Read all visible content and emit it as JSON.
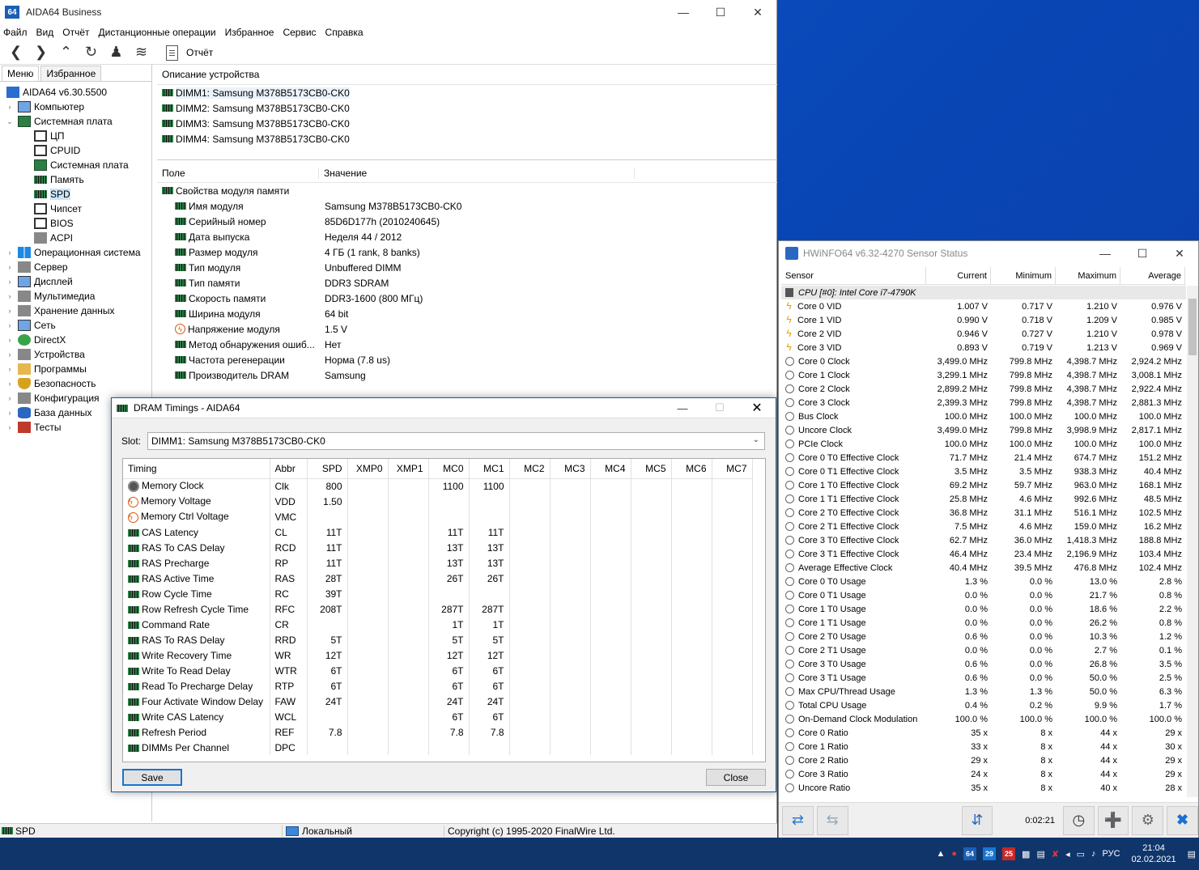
{
  "aida": {
    "title": "AIDA64 Business",
    "app_icon": "64",
    "menu": [
      "Файл",
      "Вид",
      "Отчёт",
      "Дистанционные операции",
      "Избранное",
      "Сервис",
      "Справка"
    ],
    "report_label": "Отчёт",
    "tabs": [
      "Меню",
      "Избранное"
    ],
    "tree": [
      {
        "label": "AIDA64 v6.30.5500",
        "level": 0,
        "icon": "aida64-icon",
        "exp": ""
      },
      {
        "label": "Компьютер",
        "level": 1,
        "icon": "computer-icon",
        "exp": "›"
      },
      {
        "label": "Системная плата",
        "level": 1,
        "icon": "motherboard-icon",
        "exp": "⌄"
      },
      {
        "label": "ЦП",
        "level": 2,
        "icon": "cpu-icon",
        "exp": ""
      },
      {
        "label": "CPUID",
        "level": 2,
        "icon": "cpuid-icon",
        "exp": ""
      },
      {
        "label": "Системная плата",
        "level": 2,
        "icon": "board-icon",
        "exp": ""
      },
      {
        "label": "Память",
        "level": 2,
        "icon": "memory-icon",
        "exp": ""
      },
      {
        "label": "SPD",
        "level": 2,
        "icon": "spd-icon",
        "exp": "",
        "selected": true
      },
      {
        "label": "Чипсет",
        "level": 2,
        "icon": "chipset-icon",
        "exp": ""
      },
      {
        "label": "BIOS",
        "level": 2,
        "icon": "bios-icon",
        "exp": ""
      },
      {
        "label": "ACPI",
        "level": 2,
        "icon": "acpi-icon",
        "exp": ""
      },
      {
        "label": "Операционная система",
        "level": 1,
        "icon": "windows-icon",
        "exp": "›"
      },
      {
        "label": "Сервер",
        "level": 1,
        "icon": "server-icon",
        "exp": "›"
      },
      {
        "label": "Дисплей",
        "level": 1,
        "icon": "display-icon",
        "exp": "›"
      },
      {
        "label": "Мультимедиа",
        "level": 1,
        "icon": "multimedia-icon",
        "exp": "›"
      },
      {
        "label": "Хранение данных",
        "level": 1,
        "icon": "storage-icon",
        "exp": "›"
      },
      {
        "label": "Сеть",
        "level": 1,
        "icon": "network-icon",
        "exp": "›"
      },
      {
        "label": "DirectX",
        "level": 1,
        "icon": "directx-icon",
        "exp": "›"
      },
      {
        "label": "Устройства",
        "level": 1,
        "icon": "devices-icon",
        "exp": "›"
      },
      {
        "label": "Программы",
        "level": 1,
        "icon": "programs-icon",
        "exp": "›"
      },
      {
        "label": "Безопасность",
        "level": 1,
        "icon": "security-icon",
        "exp": "›"
      },
      {
        "label": "Конфигурация",
        "level": 1,
        "icon": "config-icon",
        "exp": "›"
      },
      {
        "label": "База данных",
        "level": 1,
        "icon": "database-icon",
        "exp": "›"
      },
      {
        "label": "Тесты",
        "level": 1,
        "icon": "tests-icon",
        "exp": "›"
      }
    ],
    "device_header": "Описание устройства",
    "devices": [
      "DIMM1: Samsung M378B5173CB0-CK0",
      "DIMM2: Samsung M378B5173CB0-CK0",
      "DIMM3: Samsung M378B5173CB0-CK0",
      "DIMM4: Samsung M378B5173CB0-CK0"
    ],
    "props_header": {
      "field": "Поле",
      "value": "Значение"
    },
    "props_group": "Свойства модуля памяти",
    "props": [
      {
        "field": "Имя модуля",
        "value": "Samsung M378B5173CB0-CK0",
        "icon": "ram"
      },
      {
        "field": "Серийный номер",
        "value": "85D6D177h (2010240645)",
        "icon": "ram"
      },
      {
        "field": "Дата выпуска",
        "value": "Неделя 44 / 2012",
        "icon": "ram"
      },
      {
        "field": "Размер модуля",
        "value": "4 ГБ (1 rank, 8 banks)",
        "icon": "ram"
      },
      {
        "field": "Тип модуля",
        "value": "Unbuffered DIMM",
        "icon": "ram"
      },
      {
        "field": "Тип памяти",
        "value": "DDR3 SDRAM",
        "icon": "ram"
      },
      {
        "field": "Скорость памяти",
        "value": "DDR3-1600 (800 МГц)",
        "icon": "ram"
      },
      {
        "field": "Ширина модуля",
        "value": "64 bit",
        "icon": "ram"
      },
      {
        "field": "Напряжение модуля",
        "value": "1.5 V",
        "icon": "bolt"
      },
      {
        "field": "Метод обнаружения ошиб...",
        "value": "Нет",
        "icon": "ram"
      },
      {
        "field": "Частота регенерации",
        "value": "Норма (7.8 us)",
        "icon": "ram"
      },
      {
        "field": "Производитель DRAM",
        "value": "Samsung",
        "icon": "ram"
      }
    ],
    "status": {
      "left": "SPD",
      "mid": "Локальный",
      "right": "Copyright (c) 1995-2020 FinalWire Ltd."
    }
  },
  "dram": {
    "title": "DRAM Timings - AIDA64",
    "slot_label": "Slot:",
    "slot_value": "DIMM1: Samsung M378B5173CB0-CK0",
    "columns": [
      "Timing",
      "Abbr",
      "SPD",
      "XMP0",
      "XMP1",
      "MC0",
      "MC1",
      "MC2",
      "MC3",
      "MC4",
      "MC5",
      "MC6",
      "MC7"
    ],
    "rows": [
      {
        "name": "Memory Clock",
        "icon": "clock",
        "cells": [
          "Clk",
          "800",
          "",
          "",
          "1100",
          "1100",
          "",
          "",
          "",
          "",
          "",
          ""
        ]
      },
      {
        "name": "Memory Voltage",
        "icon": "bolt",
        "cells": [
          "VDD",
          "1.50",
          "",
          "",
          "",
          "",
          "",
          "",
          "",
          "",
          "",
          ""
        ]
      },
      {
        "name": "Memory Ctrl Voltage",
        "icon": "bolt",
        "cells": [
          "VMC",
          "",
          "",
          "",
          "",
          "",
          "",
          "",
          "",
          "",
          "",
          ""
        ]
      },
      {
        "name": "CAS Latency",
        "icon": "ram",
        "cells": [
          "CL",
          "11T",
          "",
          "",
          "11T",
          "11T",
          "",
          "",
          "",
          "",
          "",
          ""
        ]
      },
      {
        "name": "RAS To CAS Delay",
        "icon": "ram",
        "cells": [
          "RCD",
          "11T",
          "",
          "",
          "13T",
          "13T",
          "",
          "",
          "",
          "",
          "",
          ""
        ]
      },
      {
        "name": "RAS Precharge",
        "icon": "ram",
        "cells": [
          "RP",
          "11T",
          "",
          "",
          "13T",
          "13T",
          "",
          "",
          "",
          "",
          "",
          ""
        ]
      },
      {
        "name": "RAS Active Time",
        "icon": "ram",
        "cells": [
          "RAS",
          "28T",
          "",
          "",
          "26T",
          "26T",
          "",
          "",
          "",
          "",
          "",
          ""
        ]
      },
      {
        "name": "Row Cycle Time",
        "icon": "ram",
        "cells": [
          "RC",
          "39T",
          "",
          "",
          "",
          "",
          "",
          "",
          "",
          "",
          "",
          ""
        ]
      },
      {
        "name": "Row Refresh Cycle Time",
        "icon": "ram",
        "cells": [
          "RFC",
          "208T",
          "",
          "",
          "287T",
          "287T",
          "",
          "",
          "",
          "",
          "",
          ""
        ]
      },
      {
        "name": "Command Rate",
        "icon": "ram",
        "cells": [
          "CR",
          "",
          "",
          "",
          "1T",
          "1T",
          "",
          "",
          "",
          "",
          "",
          ""
        ]
      },
      {
        "name": "RAS To RAS Delay",
        "icon": "ram",
        "cells": [
          "RRD",
          "5T",
          "",
          "",
          "5T",
          "5T",
          "",
          "",
          "",
          "",
          "",
          ""
        ]
      },
      {
        "name": "Write Recovery Time",
        "icon": "ram",
        "cells": [
          "WR",
          "12T",
          "",
          "",
          "12T",
          "12T",
          "",
          "",
          "",
          "",
          "",
          ""
        ]
      },
      {
        "name": "Write To Read Delay",
        "icon": "ram",
        "cells": [
          "WTR",
          "6T",
          "",
          "",
          "6T",
          "6T",
          "",
          "",
          "",
          "",
          "",
          ""
        ]
      },
      {
        "name": "Read To Precharge Delay",
        "icon": "ram",
        "cells": [
          "RTP",
          "6T",
          "",
          "",
          "6T",
          "6T",
          "",
          "",
          "",
          "",
          "",
          ""
        ]
      },
      {
        "name": "Four Activate Window Delay",
        "icon": "ram",
        "cells": [
          "FAW",
          "24T",
          "",
          "",
          "24T",
          "24T",
          "",
          "",
          "",
          "",
          "",
          ""
        ]
      },
      {
        "name": "Write CAS Latency",
        "icon": "ram",
        "cells": [
          "WCL",
          "",
          "",
          "",
          "6T",
          "6T",
          "",
          "",
          "",
          "",
          "",
          ""
        ]
      },
      {
        "name": "Refresh Period",
        "icon": "ram",
        "cells": [
          "REF",
          "7.8",
          "",
          "",
          "7.8",
          "7.8",
          "",
          "",
          "",
          "",
          "",
          ""
        ]
      },
      {
        "name": "DIMMs Per Channel",
        "icon": "ram",
        "cells": [
          "DPC",
          "",
          "",
          "",
          "",
          "",
          "",
          "",
          "",
          "",
          "",
          ""
        ]
      }
    ],
    "save_label": "Save",
    "close_label": "Close"
  },
  "hwinfo": {
    "title": "HWiNFO64 v6.32-4270 Sensor Status",
    "columns": [
      "Sensor",
      "Current",
      "Minimum",
      "Maximum",
      "Average"
    ],
    "group": "CPU [#0]: Intel Core i7-4790K",
    "rows": [
      {
        "name": "Core 0 VID",
        "icon": "volt",
        "vals": [
          "1.007 V",
          "0.717 V",
          "1.210 V",
          "0.976 V"
        ]
      },
      {
        "name": "Core 1 VID",
        "icon": "volt",
        "vals": [
          "0.990 V",
          "0.718 V",
          "1.209 V",
          "0.985 V"
        ]
      },
      {
        "name": "Core 2 VID",
        "icon": "volt",
        "vals": [
          "0.946 V",
          "0.727 V",
          "1.210 V",
          "0.978 V"
        ]
      },
      {
        "name": "Core 3 VID",
        "icon": "volt",
        "vals": [
          "0.893 V",
          "0.719 V",
          "1.213 V",
          "0.969 V"
        ]
      },
      {
        "name": "Core 0 Clock",
        "icon": "clock",
        "vals": [
          "3,499.0 MHz",
          "799.8 MHz",
          "4,398.7 MHz",
          "2,924.2 MHz"
        ]
      },
      {
        "name": "Core 1 Clock",
        "icon": "clock",
        "vals": [
          "3,299.1 MHz",
          "799.8 MHz",
          "4,398.7 MHz",
          "3,008.1 MHz"
        ]
      },
      {
        "name": "Core 2 Clock",
        "icon": "clock",
        "vals": [
          "2,899.2 MHz",
          "799.8 MHz",
          "4,398.7 MHz",
          "2,922.4 MHz"
        ]
      },
      {
        "name": "Core 3 Clock",
        "icon": "clock",
        "vals": [
          "2,399.3 MHz",
          "799.8 MHz",
          "4,398.7 MHz",
          "2,881.3 MHz"
        ]
      },
      {
        "name": "Bus Clock",
        "icon": "clock",
        "vals": [
          "100.0 MHz",
          "100.0 MHz",
          "100.0 MHz",
          "100.0 MHz"
        ]
      },
      {
        "name": "Uncore Clock",
        "icon": "clock",
        "vals": [
          "3,499.0 MHz",
          "799.8 MHz",
          "3,998.9 MHz",
          "2,817.1 MHz"
        ]
      },
      {
        "name": "PCIe Clock",
        "icon": "clock",
        "vals": [
          "100.0 MHz",
          "100.0 MHz",
          "100.0 MHz",
          "100.0 MHz"
        ]
      },
      {
        "name": "Core 0 T0 Effective Clock",
        "icon": "clock",
        "vals": [
          "71.7 MHz",
          "21.4 MHz",
          "674.7 MHz",
          "151.2 MHz"
        ]
      },
      {
        "name": "Core 0 T1 Effective Clock",
        "icon": "clock",
        "vals": [
          "3.5 MHz",
          "3.5 MHz",
          "938.3 MHz",
          "40.4 MHz"
        ]
      },
      {
        "name": "Core 1 T0 Effective Clock",
        "icon": "clock",
        "vals": [
          "69.2 MHz",
          "59.7 MHz",
          "963.0 MHz",
          "168.1 MHz"
        ]
      },
      {
        "name": "Core 1 T1 Effective Clock",
        "icon": "clock",
        "vals": [
          "25.8 MHz",
          "4.6 MHz",
          "992.6 MHz",
          "48.5 MHz"
        ]
      },
      {
        "name": "Core 2 T0 Effective Clock",
        "icon": "clock",
        "vals": [
          "36.8 MHz",
          "31.1 MHz",
          "516.1 MHz",
          "102.5 MHz"
        ]
      },
      {
        "name": "Core 2 T1 Effective Clock",
        "icon": "clock",
        "vals": [
          "7.5 MHz",
          "4.6 MHz",
          "159.0 MHz",
          "16.2 MHz"
        ]
      },
      {
        "name": "Core 3 T0 Effective Clock",
        "icon": "clock",
        "vals": [
          "62.7 MHz",
          "36.0 MHz",
          "1,418.3 MHz",
          "188.8 MHz"
        ]
      },
      {
        "name": "Core 3 T1 Effective Clock",
        "icon": "clock",
        "vals": [
          "46.4 MHz",
          "23.4 MHz",
          "2,196.9 MHz",
          "103.4 MHz"
        ]
      },
      {
        "name": "Average Effective Clock",
        "icon": "clock",
        "vals": [
          "40.4 MHz",
          "39.5 MHz",
          "476.8 MHz",
          "102.4 MHz"
        ]
      },
      {
        "name": "Core 0 T0 Usage",
        "icon": "clock",
        "vals": [
          "1.3 %",
          "0.0 %",
          "13.0 %",
          "2.8 %"
        ]
      },
      {
        "name": "Core 0 T1 Usage",
        "icon": "clock",
        "vals": [
          "0.0 %",
          "0.0 %",
          "21.7 %",
          "0.8 %"
        ]
      },
      {
        "name": "Core 1 T0 Usage",
        "icon": "clock",
        "vals": [
          "0.0 %",
          "0.0 %",
          "18.6 %",
          "2.2 %"
        ]
      },
      {
        "name": "Core 1 T1 Usage",
        "icon": "clock",
        "vals": [
          "0.0 %",
          "0.0 %",
          "26.2 %",
          "0.8 %"
        ]
      },
      {
        "name": "Core 2 T0 Usage",
        "icon": "clock",
        "vals": [
          "0.6 %",
          "0.0 %",
          "10.3 %",
          "1.2 %"
        ]
      },
      {
        "name": "Core 2 T1 Usage",
        "icon": "clock",
        "vals": [
          "0.0 %",
          "0.0 %",
          "2.7 %",
          "0.1 %"
        ]
      },
      {
        "name": "Core 3 T0 Usage",
        "icon": "clock",
        "vals": [
          "0.6 %",
          "0.0 %",
          "26.8 %",
          "3.5 %"
        ]
      },
      {
        "name": "Core 3 T1 Usage",
        "icon": "clock",
        "vals": [
          "0.6 %",
          "0.0 %",
          "50.0 %",
          "2.5 %"
        ]
      },
      {
        "name": "Max CPU/Thread Usage",
        "icon": "clock",
        "vals": [
          "1.3 %",
          "1.3 %",
          "50.0 %",
          "6.3 %"
        ]
      },
      {
        "name": "Total CPU Usage",
        "icon": "clock",
        "vals": [
          "0.4 %",
          "0.2 %",
          "9.9 %",
          "1.7 %"
        ]
      },
      {
        "name": "On-Demand Clock Modulation",
        "icon": "clock",
        "vals": [
          "100.0 %",
          "100.0 %",
          "100.0 %",
          "100.0 %"
        ]
      },
      {
        "name": "Core 0 Ratio",
        "icon": "clock",
        "vals": [
          "35 x",
          "8 x",
          "44 x",
          "29 x"
        ]
      },
      {
        "name": "Core 1 Ratio",
        "icon": "clock",
        "vals": [
          "33 x",
          "8 x",
          "44 x",
          "30 x"
        ]
      },
      {
        "name": "Core 2 Ratio",
        "icon": "clock",
        "vals": [
          "29 x",
          "8 x",
          "44 x",
          "29 x"
        ]
      },
      {
        "name": "Core 3 Ratio",
        "icon": "clock",
        "vals": [
          "24 x",
          "8 x",
          "44 x",
          "29 x"
        ]
      },
      {
        "name": "Uncore Ratio",
        "icon": "clock",
        "vals": [
          "35 x",
          "8 x",
          "40 x",
          "28 x"
        ]
      }
    ],
    "timer": "0:02:21"
  },
  "taskbar": {
    "lang": "РУС",
    "time": "21:04",
    "date": "02.02.2021",
    "tray_badges": [
      "64",
      "29",
      "25"
    ]
  }
}
